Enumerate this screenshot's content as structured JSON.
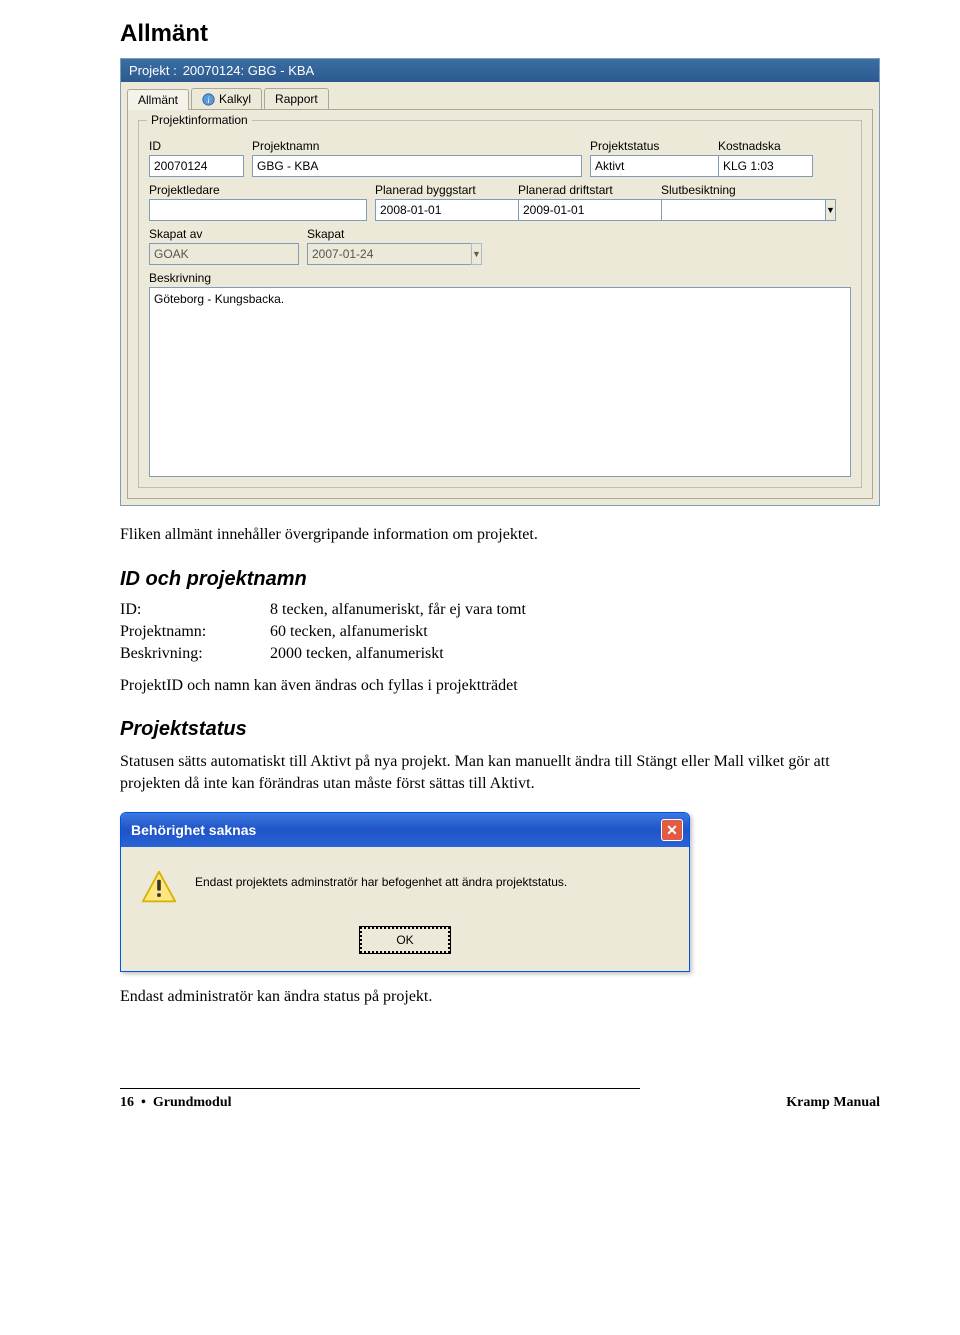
{
  "page": {
    "heading": "Allmänt",
    "intro": "Fliken allmänt innehåller övergripande information om projektet."
  },
  "window": {
    "title_label": "Projekt :",
    "title_value": "20070124: GBG - KBA",
    "tabs": [
      {
        "label": "Allmänt"
      },
      {
        "label": "Kalkyl"
      },
      {
        "label": "Rapport"
      }
    ],
    "groupbox_legend": "Projektinformation",
    "labels": {
      "id": "ID",
      "projektnamn": "Projektnamn",
      "projektstatus": "Projektstatus",
      "kostnadskalkyl": "Kostnadska",
      "projektledare": "Projektledare",
      "planerad_byggstart": "Planerad byggstart",
      "planerad_driftstart": "Planerad driftstart",
      "slutbesiktning": "Slutbesiktning",
      "skapat_av": "Skapat av",
      "skapat": "Skapat",
      "beskrivning": "Beskrivning"
    },
    "values": {
      "id": "20070124",
      "projektnamn": "GBG - KBA",
      "projektstatus": "Aktivt",
      "kostnadskalkyl": "KLG 1:03",
      "projektledare": "",
      "planerad_byggstart": "2008-01-01",
      "planerad_driftstart": "2009-01-01",
      "slutbesiktning": "",
      "skapat_av": "GOAK",
      "skapat": "2007-01-24",
      "beskrivning": "Göteborg - Kungsbacka."
    }
  },
  "section_id": {
    "heading": "ID och projektnamn",
    "rows": [
      {
        "k": "ID:",
        "v": "8 tecken, alfanumeriskt, får ej vara tomt"
      },
      {
        "k": "Projektnamn:",
        "v": "60 tecken, alfanumeriskt"
      },
      {
        "k": "Beskrivning:",
        "v": "2000 tecken, alfanumeriskt"
      }
    ],
    "note": "ProjektID och namn kan även ändras och fyllas i projektträdet"
  },
  "section_status": {
    "heading": "Projektstatus",
    "body": "Statusen sätts automatiskt till Aktivt på nya projekt. Man kan manuellt ändra till Stängt eller Mall vilket gör att projekten då inte kan förändras utan måste först sättas till Aktivt.",
    "caption": "Endast administratör kan ändra status på projekt."
  },
  "dialog": {
    "title": "Behörighet saknas",
    "message": "Endast projektets adminstratör har befogenhet att ändra projektstatus.",
    "ok": "OK"
  },
  "footer": {
    "left_page": "16",
    "left_bullet": "•",
    "left_section": "Grundmodul",
    "right": "Kramp Manual"
  }
}
